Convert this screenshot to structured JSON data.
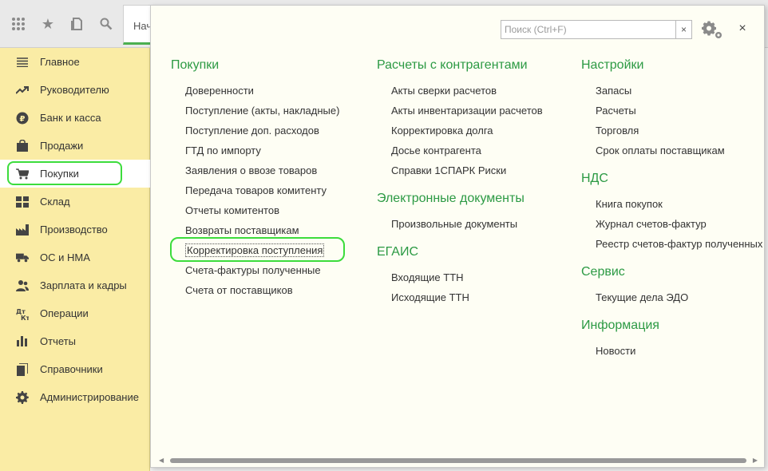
{
  "topbar": {
    "icons": [
      "grid-icon",
      "star-icon",
      "history-icon",
      "search-icon"
    ],
    "tab_label": "Начальная страница"
  },
  "sidebar": {
    "items": [
      {
        "label": "Главное",
        "icon": "menu-lines-icon"
      },
      {
        "label": "Руководителю",
        "icon": "trend-icon"
      },
      {
        "label": "Банк и касса",
        "icon": "ruble-icon"
      },
      {
        "label": "Продажи",
        "icon": "bag-icon"
      },
      {
        "label": "Покупки",
        "icon": "cart-icon"
      },
      {
        "label": "Склад",
        "icon": "warehouse-icon"
      },
      {
        "label": "Производство",
        "icon": "factory-icon"
      },
      {
        "label": "ОС и НМА",
        "icon": "truck-icon"
      },
      {
        "label": "Зарплата и кадры",
        "icon": "people-icon"
      },
      {
        "label": "Операции",
        "icon": "dt-kt-icon"
      },
      {
        "label": "Отчеты",
        "icon": "bar-chart-icon"
      },
      {
        "label": "Справочники",
        "icon": "books-icon"
      },
      {
        "label": "Администрирование",
        "icon": "gear-icon"
      }
    ],
    "active_index": 4
  },
  "panel": {
    "search_placeholder": "Поиск (Ctrl+F)",
    "clear_label": "×",
    "close_label": "×",
    "columns": [
      {
        "sections": [
          {
            "title": "Покупки",
            "items": [
              "Доверенности",
              "Поступление (акты, накладные)",
              "Поступление доп. расходов",
              "ГТД по импорту",
              "Заявления о ввозе товаров",
              "Передача товаров комитенту",
              "Отчеты комитентов",
              "Возвраты поставщикам",
              "Корректировка поступления",
              "Счета-фактуры полученные",
              "Счета от поставщиков"
            ]
          }
        ]
      },
      {
        "sections": [
          {
            "title": "Расчеты с контрагентами",
            "items": [
              "Акты сверки расчетов",
              "Акты инвентаризации расчетов",
              "Корректировка долга",
              "Досье контрагента",
              "Справки 1СПАРК Риски"
            ]
          },
          {
            "title": "Электронные документы",
            "items": [
              "Произвольные документы"
            ]
          },
          {
            "title": "ЕГАИС",
            "items": [
              "Входящие ТТН",
              "Исходящие ТТН"
            ]
          }
        ]
      },
      {
        "sections": [
          {
            "title": "Настройки",
            "items": [
              "Запасы",
              "Расчеты",
              "Торговля",
              "Срок оплаты поставщикам"
            ]
          },
          {
            "title": "НДС",
            "items": [
              "Книга покупок",
              "Журнал счетов-фактур",
              "Реестр счетов-фактур полученных"
            ]
          },
          {
            "title": "Сервис",
            "items": [
              "Текущие дела ЭДО"
            ]
          },
          {
            "title": "Информация",
            "items": [
              "Новости"
            ]
          }
        ]
      }
    ]
  }
}
